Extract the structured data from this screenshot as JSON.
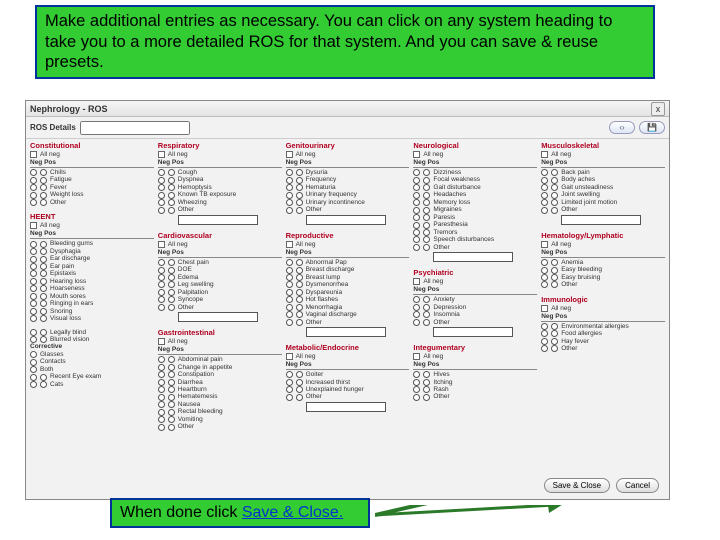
{
  "callout_top": "Make additional entries as necessary. You can click on any system heading to take you to a more detailed ROS for that system. And you can save & reuse presets.",
  "callout_bottom_pre": "When done click ",
  "callout_bottom_link": "Save & Close.",
  "window": {
    "title": "Nephrology - ROS",
    "details_label": "ROS Details",
    "save_close": "Save & Close",
    "cancel": "Cancel"
  },
  "np": "Neg  Pos",
  "other": "Other",
  "allneg": "All neg",
  "s": {
    "constitutional": {
      "title": "Constitutional",
      "items": [
        "Chills",
        "Fatigue",
        "Fever",
        "Weight loss",
        "Other"
      ]
    },
    "heent": {
      "title": "HEENT",
      "items": [
        "Bleeding gums",
        "Dysphagia",
        "Ear discharge",
        "Ear pain",
        "Epistaxis",
        "Hearing loss",
        "Hoarseness",
        "Mouth sores",
        "Ringing in ears",
        "Snoring",
        "Visual loss"
      ]
    },
    "eyes_extra": {
      "legally_blind": "Legally blind",
      "blurred": "Blurred vision",
      "corrective": "Corrective",
      "glasses": "Glasses",
      "contacts": "Contacts",
      "both": "Both",
      "recent_exam": "Recent Eye exam",
      "cats": "Cats"
    },
    "respiratory": {
      "title": "Respiratory",
      "items": [
        "Cough",
        "Dyspnea",
        "Hemoptysis",
        "Known TB exposure",
        "Wheezing",
        "Other"
      ]
    },
    "cardiovascular": {
      "title": "Cardiovascular",
      "items": [
        "Chest pain",
        "DOE",
        "Edema",
        "Leg swelling",
        "Palpitation",
        "Syncope",
        "Other"
      ]
    },
    "gastrointestinal": {
      "title": "Gastrointestinal",
      "items": [
        "Abdominal pain",
        "Change in appetite",
        "Constipation",
        "Diarrhea",
        "Heartburn",
        "Hematemesis",
        "Nausea",
        "Rectal bleeding",
        "Vomiting",
        "Other"
      ]
    },
    "genitourinary": {
      "title": "Genitourinary",
      "items": [
        "Dysuria",
        "Frequency",
        "Hematuria",
        "Urinary frequency",
        "Urinary incontinence",
        "Other"
      ]
    },
    "reproductive": {
      "title": "Reproductive",
      "items": [
        "Abnormal Pap",
        "Breast discharge",
        "Breast lump",
        "Dysmenorrhea",
        "Dyspareunia",
        "Hot flashes",
        "Menorrhagia",
        "Vaginal discharge",
        "Other"
      ]
    },
    "metabolic": {
      "title": "Metabolic/Endocrine",
      "items": [
        "Goiter",
        "Increased thirst",
        "Unexplained hunger",
        "Other"
      ]
    },
    "neurological": {
      "title": "Neurological",
      "items": [
        "Dizziness",
        "Focal weakness",
        "Gait disturbance",
        "Headaches",
        "Memory loss",
        "Migraines",
        "Paresis",
        "Paresthesia",
        "Tremors",
        "Speech disturbances",
        "Other"
      ]
    },
    "psychiatric": {
      "title": "Psychiatric",
      "items": [
        "Anxiety",
        "Depression",
        "Insomnia",
        "Other"
      ]
    },
    "integumentary": {
      "title": "Integumentary",
      "items": [
        "Hives",
        "Itching",
        "Rash",
        "Other"
      ]
    },
    "musculoskeletal": {
      "title": "Musculoskeletal",
      "items": [
        "Back pain",
        "Body aches",
        "Gait unsteadiness",
        "Joint swelling",
        "Limited joint motion",
        "Other"
      ]
    },
    "hematology": {
      "title": "Hematology/Lymphatic",
      "items": [
        "Anemia",
        "Easy bleeding",
        "Easy bruising",
        "Other"
      ]
    },
    "immunologic": {
      "title": "Immunologic",
      "items": [
        "Environmental allergies",
        "Food allergies",
        "Hay fever",
        "Other"
      ]
    }
  }
}
